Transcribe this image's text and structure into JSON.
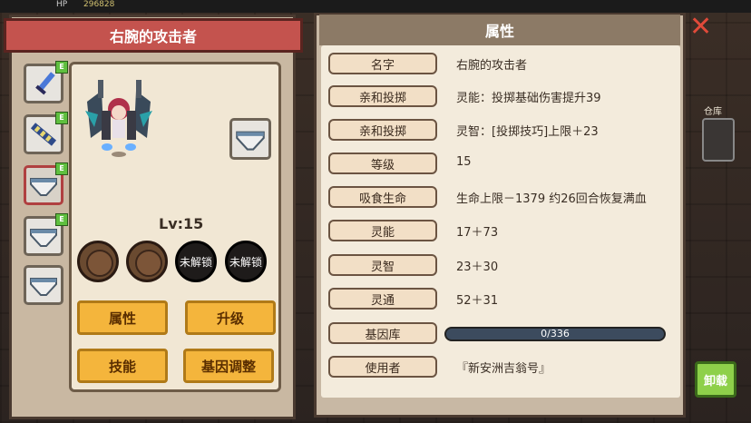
{
  "hud": {
    "hp_label": "HP",
    "hp_value": "296828"
  },
  "equipment": {
    "title": "右腕的攻击者",
    "slots": [
      {
        "icon": "sword-icon",
        "badge": "E"
      },
      {
        "icon": "chain-icon",
        "badge": "E"
      },
      {
        "icon": "underwear-icon",
        "badge": "E"
      },
      {
        "icon": "underwear-icon",
        "badge": "E"
      },
      {
        "icon": "underwear-icon",
        "badge": ""
      }
    ],
    "level": "Lv:15",
    "sockets": [
      {
        "state": "open",
        "label": ""
      },
      {
        "state": "open",
        "label": ""
      },
      {
        "state": "locked",
        "label": "未解锁"
      },
      {
        "state": "locked",
        "label": "未解锁"
      }
    ],
    "buttons": {
      "attributes": "属性",
      "upgrade": "升级",
      "skills": "技能",
      "gene_adjust": "基因调整"
    }
  },
  "attributes": {
    "header": "属性",
    "rows": [
      {
        "label": "名字",
        "value": "右腕的攻击者"
      },
      {
        "label": "亲和投掷",
        "value": "灵能：投掷基础伤害提升39"
      },
      {
        "label": "亲和投掷",
        "value": "灵智：[投掷技巧]上限＋23"
      },
      {
        "label": "等级",
        "value": "15"
      },
      {
        "label": "吸食生命",
        "value": "生命上限－1379  约26回合恢复满血"
      },
      {
        "label": "灵能",
        "value": "17＋73"
      },
      {
        "label": "灵智",
        "value": "23＋30"
      },
      {
        "label": "灵通",
        "value": "52＋31"
      },
      {
        "label": "基因库",
        "value": ""
      },
      {
        "label": "使用者",
        "value": "『新安洲吉翁号』"
      }
    ],
    "gene_bank": {
      "text": "0/336",
      "fraction": 0
    }
  },
  "side": {
    "unequip": "卸载",
    "warehouse": "仓库"
  },
  "colors": {
    "banner": "#c4534e",
    "button": "#f4b53c",
    "unequip": "#8ed04a",
    "close": "#e04a3a"
  }
}
